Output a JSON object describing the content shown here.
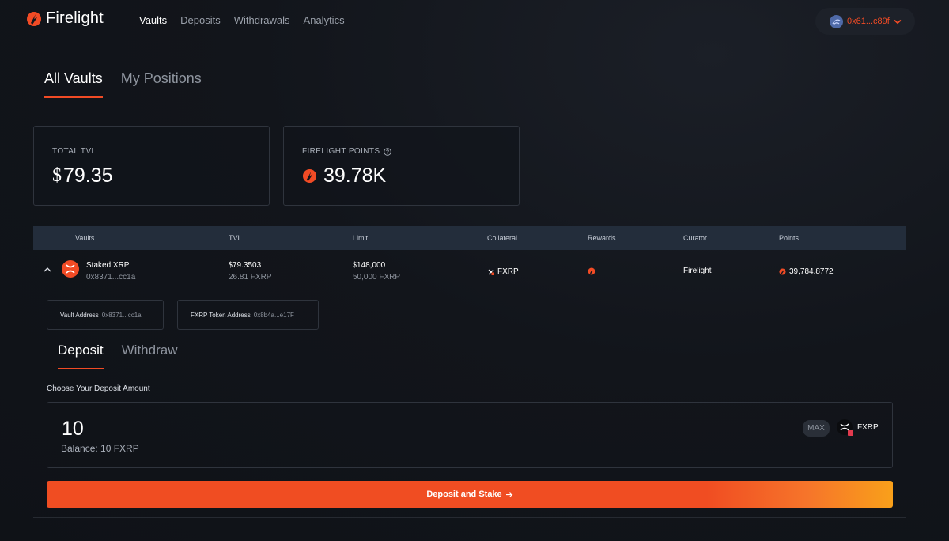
{
  "brand": {
    "name": "Firelight",
    "accent": "#f14b25"
  },
  "nav": {
    "items": [
      "Vaults",
      "Deposits",
      "Withdrawals",
      "Analytics"
    ],
    "active": "Vaults"
  },
  "wallet": {
    "address": "0x61...c89f",
    "icon": "wallet-avatar-icon"
  },
  "main_tabs": [
    {
      "label": "All Vaults",
      "active": true
    },
    {
      "label": "My Positions",
      "active": false
    }
  ],
  "stats": {
    "tvl": {
      "label": "TOTAL TVL",
      "currency": "$",
      "value": "79.35"
    },
    "points": {
      "label": "FIRELIGHT POINTS",
      "value": "39.78K"
    }
  },
  "table": {
    "headers": [
      "Vaults",
      "TVL",
      "Limit",
      "Collateral",
      "Rewards",
      "Curator",
      "Points"
    ],
    "row": {
      "vault_name": "Staked XRP",
      "vault_address": "0x8371...cc1a",
      "tvl_currency": "$",
      "tvl_value": "79.3503",
      "tvl_sub": "26.81 FXRP",
      "limit_currency": "$",
      "limit_value": "148,000",
      "limit_sub": "50,000 FXRP",
      "collateral": "FXRP",
      "curator": "Firelight",
      "points": "39,784.8772"
    }
  },
  "addresses": [
    {
      "label": "Vault Address",
      "value": "0x8371...cc1a"
    },
    {
      "label": "FXRP Token Address",
      "value": "0x8b4a...e17F"
    }
  ],
  "sub_tabs": [
    {
      "label": "Deposit",
      "active": true
    },
    {
      "label": "Withdraw",
      "active": false
    }
  ],
  "deposit": {
    "label": "Choose Your Deposit Amount",
    "amount": "10",
    "balance": "Balance: 10 FXRP",
    "max_label": "MAX",
    "token": "FXRP",
    "cta_label": "Deposit and Stake",
    "cta_icon": "arrow-right-icon"
  }
}
